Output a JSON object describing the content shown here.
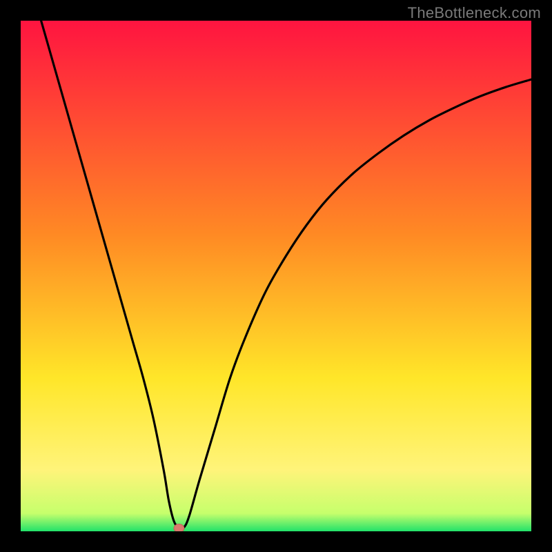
{
  "watermark": "TheBottleneck.com",
  "colors": {
    "frame_bg": "#000000",
    "gradient_top": "#ff1440",
    "gradient_mid1": "#ff8a24",
    "gradient_mid2": "#ffe629",
    "gradient_mid3": "#fff47a",
    "gradient_bottom": "#21e26a",
    "curve": "#000000",
    "marker_fill": "#d97a6d",
    "marker_stroke": "#bf6557"
  },
  "chart_data": {
    "type": "line",
    "title": "",
    "xlabel": "",
    "ylabel": "",
    "xlim": [
      0,
      100
    ],
    "ylim": [
      0,
      100
    ],
    "series": [
      {
        "name": "bottleneck-curve",
        "x": [
          4,
          6,
          8,
          10,
          12,
          14,
          16,
          18,
          20,
          22,
          24,
          26,
          28,
          29,
          30,
          31,
          32,
          33,
          35,
          38,
          41,
          44,
          48,
          52,
          56,
          60,
          65,
          70,
          75,
          80,
          85,
          90,
          95,
          100
        ],
        "y": [
          100,
          93,
          86,
          79,
          72,
          65,
          58,
          51,
          44,
          37,
          30,
          22,
          12,
          6,
          2,
          0.6,
          0.8,
          3,
          10,
          20,
          30,
          38,
          47,
          54,
          60,
          65,
          70,
          74,
          77.5,
          80.5,
          83,
          85.2,
          87,
          88.5
        ]
      }
    ],
    "marker": {
      "x": 31,
      "y": 0.6
    },
    "gradient_stops": [
      {
        "offset": 0.0,
        "color": "#ff1440"
      },
      {
        "offset": 0.42,
        "color": "#ff8a24"
      },
      {
        "offset": 0.7,
        "color": "#ffe629"
      },
      {
        "offset": 0.88,
        "color": "#fff47a"
      },
      {
        "offset": 0.965,
        "color": "#c6ff6c"
      },
      {
        "offset": 1.0,
        "color": "#21e26a"
      }
    ]
  }
}
